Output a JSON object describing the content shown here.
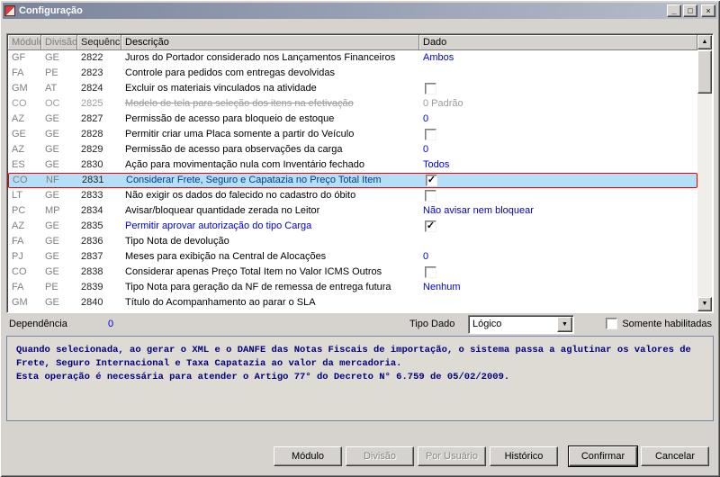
{
  "window": {
    "title": "Configuração"
  },
  "icons": {
    "minimize": "_",
    "maximize": "□",
    "close": "×",
    "check": "✓",
    "arrow_up": "▲",
    "arrow_down": "▼",
    "combo_arrow": "▼"
  },
  "colors": {
    "value_blue": "#0000d0",
    "highlight_bg": "#b4dff7",
    "highlight_border": "#e80000",
    "disabled_text": "#9c9c9c",
    "help_text": "#000080"
  },
  "table": {
    "columns": [
      "Módulo",
      "Divisão",
      "Sequência",
      "Descrição",
      "Dado"
    ],
    "rows": [
      {
        "modulo": "GF",
        "divisao": "GE",
        "sequencia": "2822",
        "descricao": "Juros do Portador considerado nos Lançamentos Financeiros",
        "dado": "Ambos",
        "dado_type": "text"
      },
      {
        "modulo": "FA",
        "divisao": "PE",
        "sequencia": "2823",
        "descricao": "Controle para pedidos com entregas devolvidas",
        "dado": "",
        "dado_type": "none"
      },
      {
        "modulo": "GM",
        "divisao": "AT",
        "sequencia": "2824",
        "descricao": "Excluir os materiais vinculados na atividade",
        "dado_type": "checkbox",
        "checked": false
      },
      {
        "modulo": "CO",
        "divisao": "OC",
        "sequencia": "2825",
        "descricao": "Modelo de tela para seleção dos itens na efetivação",
        "dado": "0 Padrão",
        "dado_type": "text-gray",
        "disabled": true
      },
      {
        "modulo": "AZ",
        "divisao": "GE",
        "sequencia": "2827",
        "descricao": "Permissão de acesso para bloqueio de estoque",
        "dado": "0",
        "dado_type": "text"
      },
      {
        "modulo": "GE",
        "divisao": "GE",
        "sequencia": "2828",
        "descricao": "Permitir criar uma Placa somente a partir do Veículo",
        "dado_type": "checkbox",
        "checked": false
      },
      {
        "modulo": "AZ",
        "divisao": "GE",
        "sequencia": "2829",
        "descricao": "Permissão de acesso para observações da carga",
        "dado": "0",
        "dado_type": "text"
      },
      {
        "modulo": "ES",
        "divisao": "GE",
        "sequencia": "2830",
        "descricao": "Ação para movimentação nula com Inventário fechado",
        "dado": "Todos",
        "dado_type": "text"
      },
      {
        "modulo": "CO",
        "divisao": "NF",
        "sequencia": "2831",
        "descricao": "Considerar Frete, Seguro e Capatazia no Preço Total Item",
        "dado_type": "checkbox",
        "checked": true,
        "highlight": true
      },
      {
        "modulo": "LT",
        "divisao": "GE",
        "sequencia": "2833",
        "descricao": "Não exigir os dados do falecido no cadastro do óbito",
        "dado_type": "checkbox",
        "checked": false
      },
      {
        "modulo": "PC",
        "divisao": "MP",
        "sequencia": "2834",
        "descricao": "Avisar/bloquear quantidade zerada no Leitor",
        "dado": "Não avisar nem bloquear",
        "dado_type": "text"
      },
      {
        "modulo": "AZ",
        "divisao": "GE",
        "sequencia": "2835",
        "descricao": "Permitir aprovar autorização do tipo Carga",
        "dado_type": "checkbox",
        "checked": true,
        "desc_blue": true
      },
      {
        "modulo": "FA",
        "divisao": "GE",
        "sequencia": "2836",
        "descricao": "Tipo Nota de devolução",
        "dado": "",
        "dado_type": "none"
      },
      {
        "modulo": "PJ",
        "divisao": "GE",
        "sequencia": "2837",
        "descricao": "Meses para exibição na Central de Alocações",
        "dado": "0",
        "dado_type": "text"
      },
      {
        "modulo": "CO",
        "divisao": "GE",
        "sequencia": "2838",
        "descricao": "Considerar apenas Preço Total Item no Valor ICMS Outros",
        "dado_type": "checkbox",
        "checked": false
      },
      {
        "modulo": "FA",
        "divisao": "PE",
        "sequencia": "2839",
        "descricao": "Tipo Nota para geração da NF de remessa de entrega futura",
        "dado": "Nenhum",
        "dado_type": "text"
      },
      {
        "modulo": "GM",
        "divisao": "GE",
        "sequencia": "2840",
        "descricao": "Título do Acompanhamento ao parar o SLA",
        "dado": "",
        "dado_type": "none"
      }
    ]
  },
  "footer": {
    "dependencia_label": "Dependência",
    "dependencia_value": "0",
    "tipo_dado_label": "Tipo Dado",
    "tipo_dado_value": "Lógico",
    "somente_habilitadas_label": "Somente habilitadas",
    "somente_habilitadas_checked": false
  },
  "help": {
    "lines": [
      "Quando selecionada, ao gerar o XML e o DANFE das Notas Fiscais de importação, o sistema passa a aglutinar os valores de",
      "Frete, Seguro Internacional e Taxa Capatazia ao valor da mercadoria.",
      "Esta operação é necessária para atender o Artigo 77° do Decreto N° 6.759 de 05/02/2009."
    ]
  },
  "buttons": [
    {
      "label": "Módulo",
      "disabled": false,
      "default": false
    },
    {
      "label": "Divisão",
      "disabled": true,
      "default": false
    },
    {
      "label": "Por Usuário",
      "disabled": true,
      "default": false
    },
    {
      "label": "Histórico",
      "disabled": false,
      "default": false
    },
    {
      "label": "Confirmar",
      "disabled": false,
      "default": true
    },
    {
      "label": "Cancelar",
      "disabled": false,
      "default": false
    }
  ]
}
